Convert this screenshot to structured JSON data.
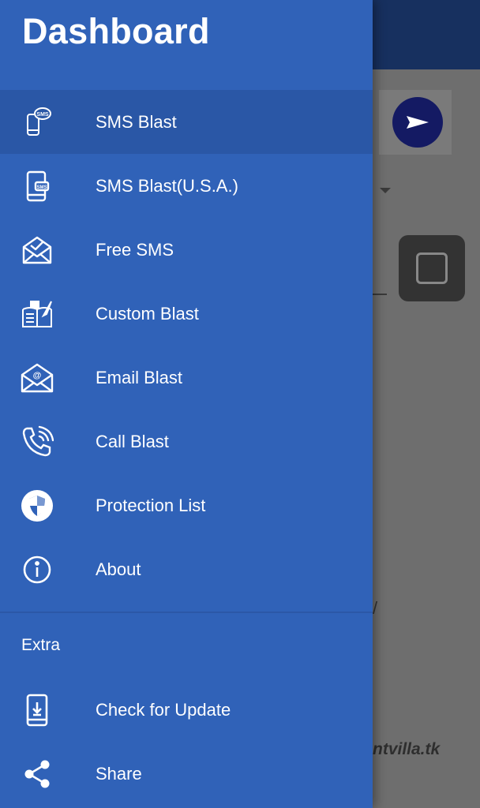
{
  "drawer": {
    "title": "Dashboard",
    "items": [
      {
        "label": "SMS Blast",
        "icon": "sms-phone-icon",
        "active": true
      },
      {
        "label": "SMS Blast(U.S.A.)",
        "icon": "mobile-sms-icon"
      },
      {
        "label": "Free SMS",
        "icon": "envelope-open-icon"
      },
      {
        "label": "Custom Blast",
        "icon": "document-quill-icon"
      },
      {
        "label": "Email Blast",
        "icon": "email-at-icon"
      },
      {
        "label": "Call Blast",
        "icon": "phone-ringing-icon"
      },
      {
        "label": "Protection List",
        "icon": "shield-icon"
      },
      {
        "label": "About",
        "icon": "info-icon"
      }
    ],
    "section_extra": "Extra",
    "extra_items": [
      {
        "label": "Check for Update",
        "icon": "download-phone-icon"
      },
      {
        "label": "Share",
        "icon": "share-icon"
      }
    ]
  },
  "background": {
    "url_fragment": "ntvilla.tk",
    "slash": "/"
  },
  "colors": {
    "drawer": "#3062b8",
    "active_item": "#2a57a6",
    "topbar": "#17305f",
    "send_button": "#141a63"
  }
}
